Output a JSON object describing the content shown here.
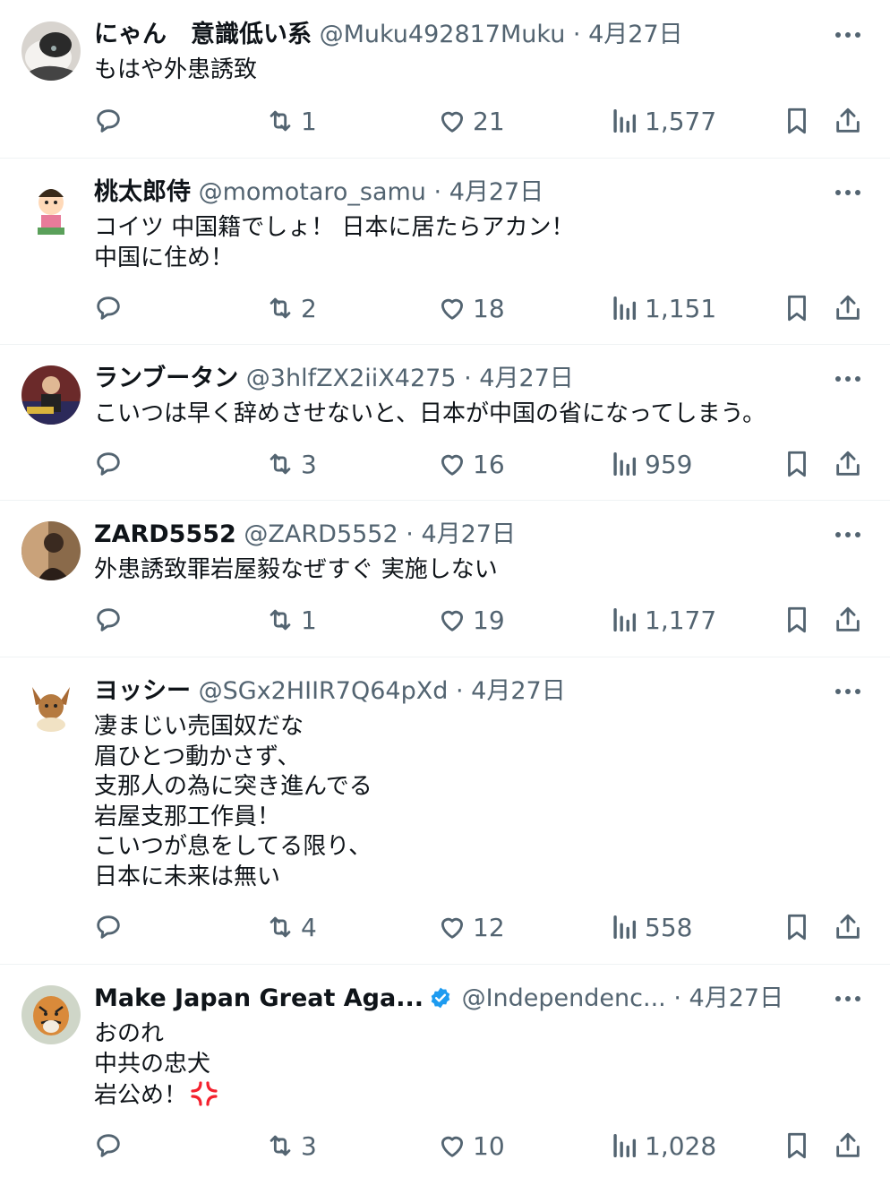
{
  "tweets": [
    {
      "name": "にゃん　意識低い系",
      "handle": "@Muku492817Muku",
      "separator": "·",
      "date": "4月27日",
      "text": "もはや外患誘致",
      "replies": "",
      "retweets": "1",
      "likes": "21",
      "views": "1,577",
      "avatar_icon": "cat-avatar"
    },
    {
      "name": "桃太郎侍",
      "handle": "@momotaro_samu",
      "separator": "·",
      "date": "4月27日",
      "text": "コイツ 中国籍でしょ！ 日本に居たらアカン！\n中国に住め！",
      "replies": "",
      "retweets": "2",
      "likes": "18",
      "views": "1,151",
      "avatar_icon": "cartoon-samurai-avatar"
    },
    {
      "name": "ランブータン",
      "handle": "@3hlfZX2iiX4275",
      "separator": "·",
      "date": "4月27日",
      "text": "こいつは早く辞めさせないと、日本が中国の省になってしまう。",
      "replies": "",
      "retweets": "3",
      "likes": "16",
      "views": "959",
      "avatar_icon": "photo-avatar"
    },
    {
      "name": "ZARD5552",
      "handle": "@ZARD5552",
      "separator": "·",
      "date": "4月27日",
      "text": "外患誘致罪岩屋毅なぜすぐ 実施しない",
      "replies": "",
      "retweets": "1",
      "likes": "19",
      "views": "1,177",
      "avatar_icon": "portrait-avatar"
    },
    {
      "name": "ヨッシー",
      "handle": "@SGx2HIIR7Q64pXd",
      "separator": "·",
      "date": "4月27日",
      "text": "凄まじい売国奴だな\n眉ひとつ動かさず、\n支那人の為に突き進んでる\n岩屋支那工作員！\nこいつが息をしてる限り、\n日本に未来は無い",
      "replies": "",
      "retweets": "4",
      "likes": "12",
      "views": "558",
      "avatar_icon": "eevee-avatar"
    },
    {
      "name": "Make Japan Great Aga...",
      "handle": "@Independenc...",
      "separator": "·",
      "date": "4月27日",
      "text": "おのれ\n中共の忠犬\n岩公め！",
      "replies": "",
      "retweets": "3",
      "likes": "10",
      "views": "1,028",
      "avatar_icon": "tiger-avatar",
      "verified": true,
      "emoji": "anger-symbol-icon"
    }
  ],
  "colors": {
    "text": "#0f1419",
    "secondary": "#536471",
    "verified": "#1d9bf0",
    "divider": "#eff3f4",
    "anger": "#f4212e"
  }
}
